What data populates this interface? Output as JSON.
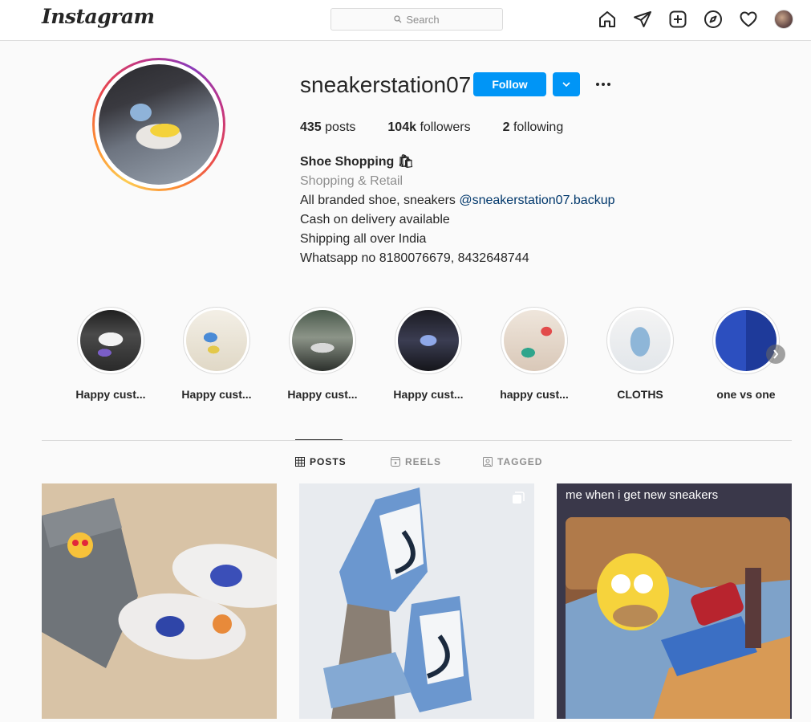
{
  "nav": {
    "logo": "Instagram",
    "search_placeholder": "Search",
    "icons": [
      "home-icon",
      "direct-icon",
      "new-post-icon",
      "explore-icon",
      "activity-icon",
      "profile-avatar"
    ]
  },
  "profile": {
    "username": "sneakerstation07",
    "follow_label": "Follow",
    "stats": {
      "posts_count": "435",
      "posts_label": "posts",
      "followers_count": "104k",
      "followers_label": "followers",
      "following_count": "2",
      "following_label": "following"
    },
    "bio": {
      "name": "Shoe Shopping 🛍",
      "category": "Shopping & Retail",
      "line1_text": "All branded shoe, sneakers",
      "line1_mention": "@sneakerstation07.backup",
      "line2": "Cash on delivery available",
      "line3": "Shipping all over India",
      "line4": "Whatsapp no 8180076679, 8432648744"
    }
  },
  "highlights": [
    {
      "label": "Happy cust..."
    },
    {
      "label": "Happy cust..."
    },
    {
      "label": "Happy cust..."
    },
    {
      "label": "Happy cust..."
    },
    {
      "label": "happy cust..."
    },
    {
      "label": "CLOTHS"
    },
    {
      "label": "one vs one"
    }
  ],
  "tabs": [
    {
      "label": "POSTS",
      "active": true
    },
    {
      "label": "REELS",
      "active": false
    },
    {
      "label": "TAGGED",
      "active": false
    }
  ],
  "posts": [
    {
      "caption": ""
    },
    {
      "caption": ""
    },
    {
      "caption": "me when i get new sneakers"
    }
  ],
  "colors": {
    "accent": "#0095f6",
    "text": "#262626",
    "secondary": "#8e8e8e",
    "mention": "#00376b",
    "border": "#dbdbdb"
  }
}
